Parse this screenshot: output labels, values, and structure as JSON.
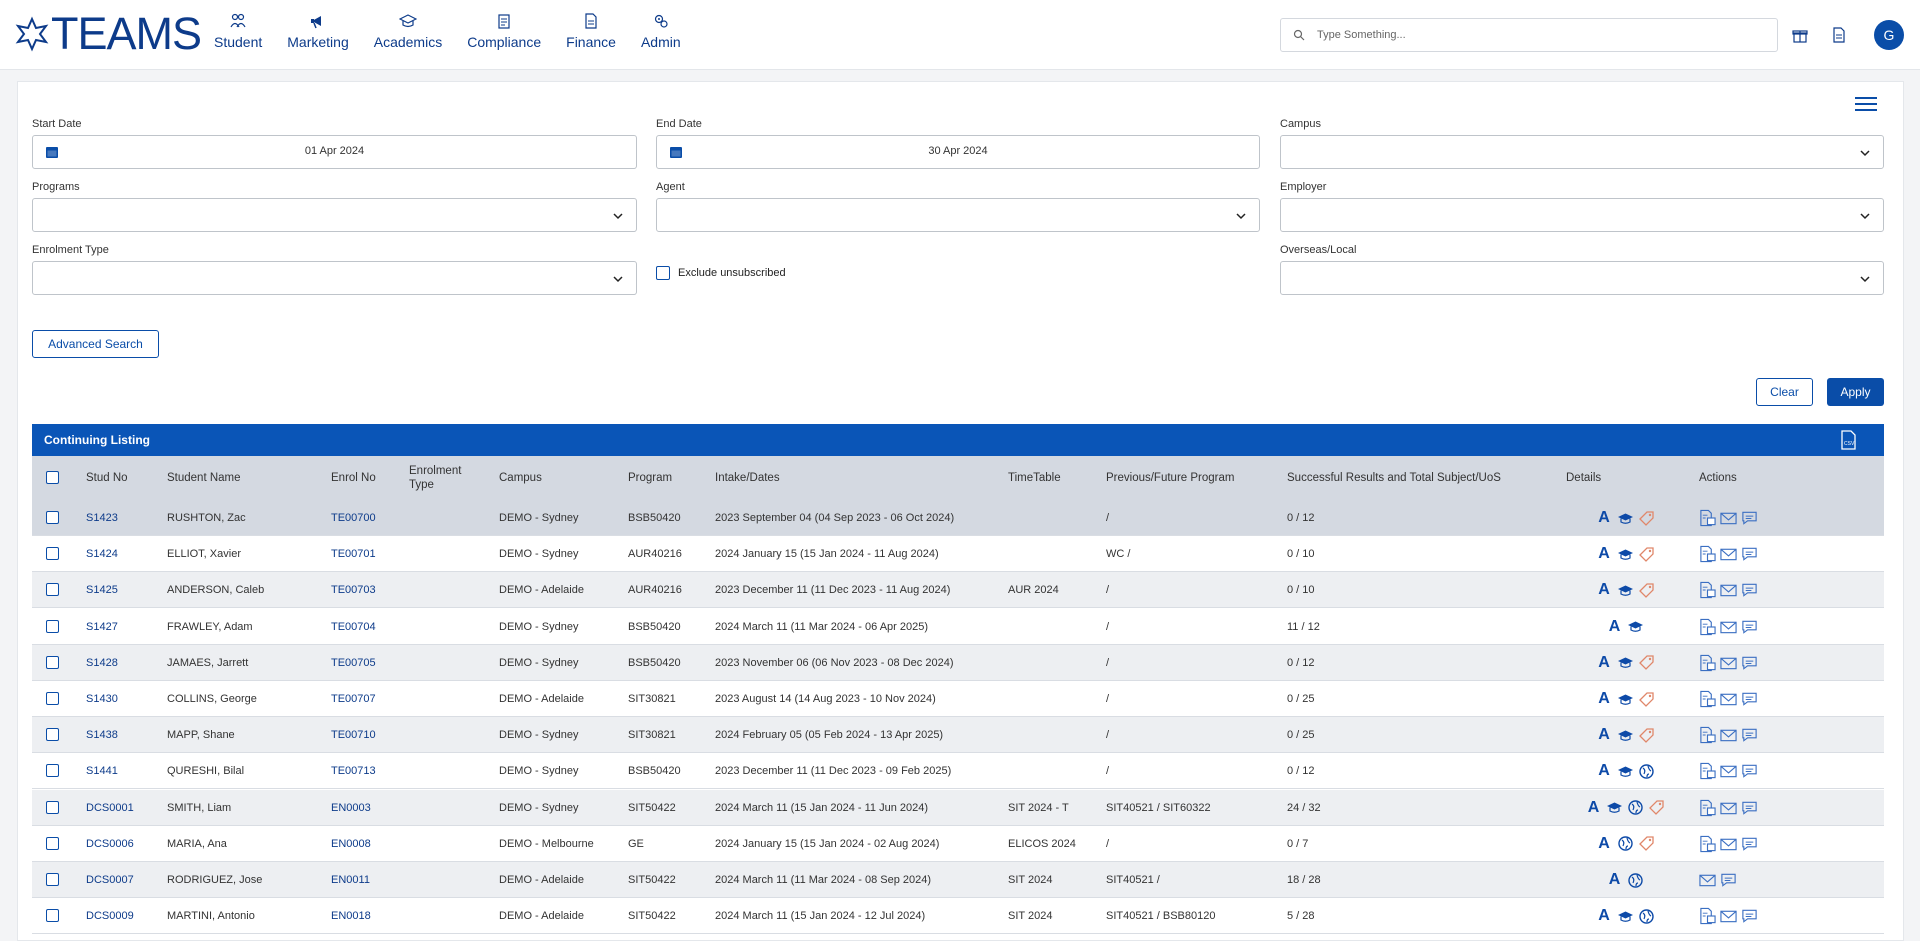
{
  "app": {
    "logo": "TEAMS"
  },
  "nav": [
    {
      "label": "Student",
      "icon": "students-icon"
    },
    {
      "label": "Marketing",
      "icon": "megaphone-icon"
    },
    {
      "label": "Academics",
      "icon": "graduation-cap-icon"
    },
    {
      "label": "Compliance",
      "icon": "clipboard-icon"
    },
    {
      "label": "Finance",
      "icon": "invoice-icon"
    },
    {
      "label": "Admin",
      "icon": "admin-gears-icon"
    }
  ],
  "search": {
    "placeholder": "Type Something..."
  },
  "user": {
    "avatar_letter": "G"
  },
  "filters": {
    "start_date": {
      "label": "Start Date",
      "value": "01 Apr 2024"
    },
    "end_date": {
      "label": "End Date",
      "value": "30 Apr 2024"
    },
    "campus": {
      "label": "Campus",
      "value": ""
    },
    "programs": {
      "label": "Programs",
      "value": ""
    },
    "agent": {
      "label": "Agent",
      "value": ""
    },
    "employer": {
      "label": "Employer",
      "value": ""
    },
    "enrolment_type": {
      "label": "Enrolment Type",
      "value": ""
    },
    "exclude_unsubscribed": {
      "label": "Exclude unsubscribed",
      "checked": false
    },
    "overseas_local": {
      "label": "Overseas/Local",
      "value": ""
    }
  },
  "buttons": {
    "advanced_search": "Advanced Search",
    "clear": "Clear",
    "apply": "Apply"
  },
  "listing": {
    "title": "Continuing Listing",
    "columns": {
      "stud_no": "Stud No",
      "student_name": "Student Name",
      "enrol_no": "Enrol No",
      "enrolment_type_1": "Enrolment",
      "enrolment_type_2": "Type",
      "campus": "Campus",
      "program": "Program",
      "intake": "Intake/Dates",
      "timetable": "TimeTable",
      "prev_future": "Previous/Future Program",
      "results": "Successful Results and Total Subject/UoS",
      "details": "Details",
      "actions": "Actions"
    },
    "rows": [
      {
        "stud_no": "S1423",
        "name": "RUSHTON, Zac",
        "enrol_no": "TE00700",
        "enrol_type": "",
        "campus": "DEMO - Sydney",
        "program": "BSB50420",
        "intake": "2023 September 04 (04 Sep 2023 - 06 Oct 2024)",
        "timetable": "",
        "prev_future": "/",
        "results": "0 / 12",
        "details": [
          "A",
          "cap",
          "tag"
        ],
        "actions": [
          "doc",
          "mail",
          "chat"
        ]
      },
      {
        "stud_no": "S1424",
        "name": "ELLIOT, Xavier",
        "enrol_no": "TE00701",
        "enrol_type": "",
        "campus": "DEMO - Sydney",
        "program": "AUR40216",
        "intake": "2024 January 15 (15 Jan 2024 - 11 Aug 2024)",
        "timetable": "",
        "prev_future": "WC /",
        "results": "0 / 10",
        "details": [
          "A",
          "cap",
          "tag"
        ],
        "actions": [
          "doc",
          "mail",
          "chat"
        ]
      },
      {
        "stud_no": "S1425",
        "name": "ANDERSON, Caleb",
        "enrol_no": "TE00703",
        "enrol_type": "",
        "campus": "DEMO - Adelaide",
        "program": "AUR40216",
        "intake": "2023 December 11 (11 Dec 2023 - 11 Aug 2024)",
        "timetable": "AUR 2024",
        "prev_future": "/",
        "results": "0 / 10",
        "details": [
          "A",
          "cap",
          "tag"
        ],
        "actions": [
          "doc",
          "mail",
          "chat"
        ]
      },
      {
        "stud_no": "S1427",
        "name": "FRAWLEY, Adam",
        "enrol_no": "TE00704",
        "enrol_type": "",
        "campus": "DEMO - Sydney",
        "program": "BSB50420",
        "intake": "2024 March 11 (11 Mar 2024 - 06 Apr 2025)",
        "timetable": "",
        "prev_future": "/",
        "results": "11 / 12",
        "details": [
          "A",
          "cap"
        ],
        "actions": [
          "doc",
          "mail",
          "chat"
        ]
      },
      {
        "stud_no": "S1428",
        "name": "JAMAES, Jarrett",
        "enrol_no": "TE00705",
        "enrol_type": "",
        "campus": "DEMO - Sydney",
        "program": "BSB50420",
        "intake": "2023 November 06 (06 Nov 2023 - 08 Dec 2024)",
        "timetable": "",
        "prev_future": "/",
        "results": "0 / 12",
        "details": [
          "A",
          "cap",
          "tag"
        ],
        "actions": [
          "doc",
          "mail",
          "chat"
        ]
      },
      {
        "stud_no": "S1430",
        "name": "COLLINS, George",
        "enrol_no": "TE00707",
        "enrol_type": "",
        "campus": "DEMO - Adelaide",
        "program": "SIT30821",
        "intake": "2023 August 14 (14 Aug 2023 - 10 Nov 2024)",
        "timetable": "",
        "prev_future": "/",
        "results": "0 / 25",
        "details": [
          "A",
          "cap",
          "tag"
        ],
        "actions": [
          "doc",
          "mail",
          "chat"
        ]
      },
      {
        "stud_no": "S1438",
        "name": "MAPP, Shane",
        "enrol_no": "TE00710",
        "enrol_type": "",
        "campus": "DEMO - Sydney",
        "program": "SIT30821",
        "intake": "2024 February 05 (05 Feb 2024 - 13 Apr 2025)",
        "timetable": "",
        "prev_future": "/",
        "results": "0 / 25",
        "details": [
          "A",
          "cap",
          "tag"
        ],
        "actions": [
          "doc",
          "mail",
          "chat"
        ]
      },
      {
        "stud_no": "S1441",
        "name": "QURESHI, Bilal",
        "enrol_no": "TE00713",
        "enrol_type": "",
        "campus": "DEMO - Sydney",
        "program": "BSB50420",
        "intake": "2023 December 11 (11 Dec 2023 - 09 Feb 2025)",
        "timetable": "",
        "prev_future": "/",
        "results": "0 / 12",
        "details": [
          "A",
          "cap",
          "globe"
        ],
        "actions": [
          "doc",
          "mail",
          "chat"
        ]
      },
      {
        "stud_no": "DCS0001",
        "name": "SMITH, Liam",
        "enrol_no": "EN0003",
        "enrol_type": "",
        "campus": "DEMO - Sydney",
        "program": "SIT50422",
        "intake": "2024 March 11 (15 Jan 2024 - 11 Jun 2024)",
        "timetable": "SIT 2024 - T",
        "prev_future": "SIT40521 / SIT60322",
        "results": "24 / 32",
        "details": [
          "A",
          "cap",
          "globe",
          "tag"
        ],
        "actions": [
          "doc",
          "mail",
          "chat"
        ]
      },
      {
        "stud_no": "DCS0006",
        "name": "MARIA, Ana",
        "enrol_no": "EN0008",
        "enrol_type": "",
        "campus": "DEMO - Melbourne",
        "program": "GE",
        "intake": "2024 January 15 (15 Jan 2024 - 02 Aug 2024)",
        "timetable": "ELICOS 2024",
        "prev_future": "/",
        "results": "0 / 7",
        "details": [
          "A",
          "globe",
          "tag"
        ],
        "actions": [
          "doc",
          "mail",
          "chat"
        ]
      },
      {
        "stud_no": "DCS0007",
        "name": "RODRIGUEZ, Jose",
        "enrol_no": "EN0011",
        "enrol_type": "",
        "campus": "DEMO - Adelaide",
        "program": "SIT50422",
        "intake": "2024 March 11 (11 Mar 2024 - 08 Sep 2024)",
        "timetable": "SIT 2024",
        "prev_future": "SIT40521 /",
        "results": "18 / 28",
        "details": [
          "A",
          "globe"
        ],
        "actions": [
          "mail",
          "chat"
        ]
      },
      {
        "stud_no": "DCS0009",
        "name": "MARTINI, Antonio",
        "enrol_no": "EN0018",
        "enrol_type": "",
        "campus": "DEMO - Adelaide",
        "program": "SIT50422",
        "intake": "2024 March 11 (15 Jan 2024 - 12 Jul 2024)",
        "timetable": "SIT 2024",
        "prev_future": "SIT40521 / BSB80120",
        "results": "5 / 28",
        "details": [
          "A",
          "cap",
          "globe"
        ],
        "actions": [
          "doc",
          "mail",
          "chat"
        ]
      }
    ]
  },
  "colors": {
    "primary": "#0a4da8",
    "header_bar": "#0a55b7",
    "tag_orange": "#e0876a"
  }
}
